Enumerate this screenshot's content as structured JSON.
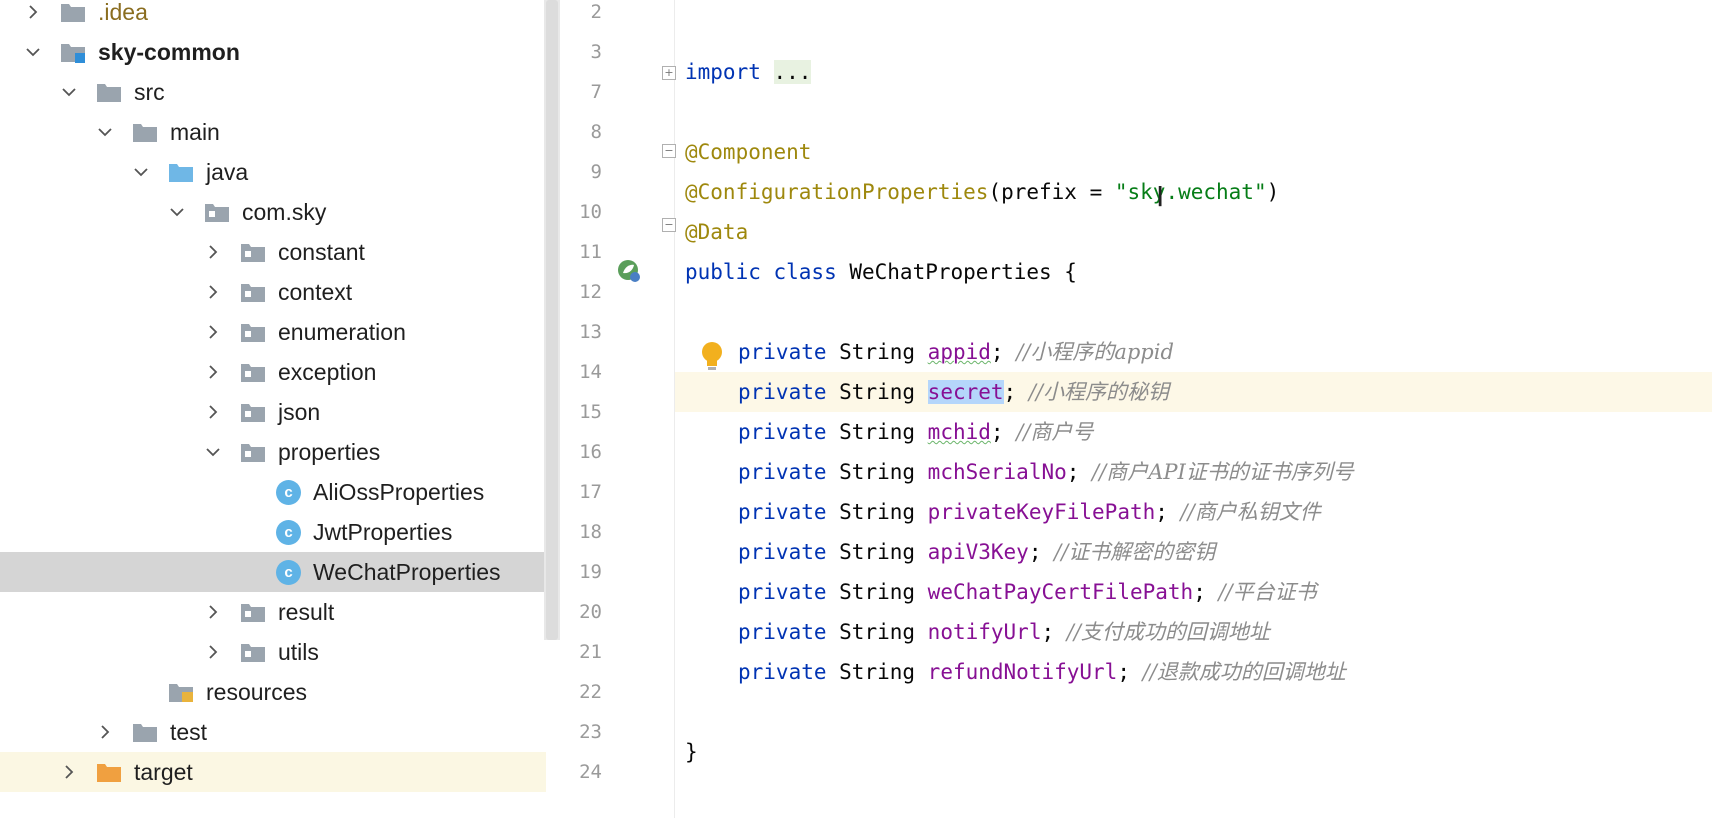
{
  "project_tree": {
    "items": [
      {
        "label": ".idea",
        "arrow": "right",
        "icon": "folder-icon"
      },
      {
        "label": "sky-common",
        "arrow": "down",
        "icon": "module-folder-icon"
      },
      {
        "label": "src",
        "arrow": "down",
        "icon": "folder-icon"
      },
      {
        "label": "main",
        "arrow": "down",
        "icon": "folder-icon"
      },
      {
        "label": "java",
        "arrow": "down",
        "icon": "source-folder-icon"
      },
      {
        "label": "com.sky",
        "arrow": "down",
        "icon": "package-icon"
      },
      {
        "label": "constant",
        "arrow": "right",
        "icon": "package-icon"
      },
      {
        "label": "context",
        "arrow": "right",
        "icon": "package-icon"
      },
      {
        "label": "enumeration",
        "arrow": "right",
        "icon": "package-icon"
      },
      {
        "label": "exception",
        "arrow": "right",
        "icon": "package-icon"
      },
      {
        "label": "json",
        "arrow": "right",
        "icon": "package-icon"
      },
      {
        "label": "properties",
        "arrow": "down",
        "icon": "package-icon"
      },
      {
        "label": "AliOssProperties",
        "arrow": "none",
        "icon": "class-icon"
      },
      {
        "label": "JwtProperties",
        "arrow": "none",
        "icon": "class-icon"
      },
      {
        "label": "WeChatProperties",
        "arrow": "none",
        "icon": "class-icon"
      },
      {
        "label": "result",
        "arrow": "right",
        "icon": "package-icon"
      },
      {
        "label": "utils",
        "arrow": "right",
        "icon": "package-icon"
      },
      {
        "label": "resources",
        "arrow": "none",
        "icon": "resources-folder-icon"
      },
      {
        "label": "test",
        "arrow": "right",
        "icon": "folder-icon"
      },
      {
        "label": "target",
        "arrow": "right",
        "icon": "excluded-folder-icon"
      }
    ],
    "class_icon_letter": "c",
    "selected": "WeChatProperties"
  },
  "editor": {
    "line_numbers": [
      "2",
      "3",
      "7",
      "8",
      "9",
      "10",
      "11",
      "12",
      "13",
      "14",
      "15",
      "16",
      "17",
      "18",
      "19",
      "20",
      "21",
      "22",
      "23",
      "24"
    ],
    "import_kw": "import",
    "import_dots": "...",
    "ann_component": "@Component",
    "ann_config": "@ConfigurationProperties",
    "prefix_open": "(prefix = ",
    "prefix_value": "\"sky.wechat\"",
    "prefix_close": ")",
    "ann_data": "@Data",
    "class_decl_kw": "public class",
    "class_name": " WeChatProperties {",
    "field_kw": "private",
    "field_type": " String ",
    "fields": [
      {
        "name": "appid",
        "comment": "//小程序的appid"
      },
      {
        "name": "secret",
        "comment": "//小程序的秘钥"
      },
      {
        "name": "mchid",
        "comment": "//商户号"
      },
      {
        "name": "mchSerialNo",
        "comment": "//商户API证书的证书序列号"
      },
      {
        "name": "privateKeyFilePath",
        "comment": "//商户私钥文件"
      },
      {
        "name": "apiV3Key",
        "comment": "//证书解密的密钥"
      },
      {
        "name": "weChatPayCertFilePath",
        "comment": "//平台证书"
      },
      {
        "name": "notifyUrl",
        "comment": "//支付成功的回调地址"
      },
      {
        "name": "refundNotifyUrl",
        "comment": "//退款成功的回调地址"
      }
    ],
    "closing_brace": "}",
    "caret_glyph": "Ⅰ",
    "colors": {
      "keyword": "#0033b3",
      "annotation": "#9e880d",
      "string": "#067d17",
      "field": "#871094",
      "comment": "#8c8c8c",
      "selection": "#b5d6fb",
      "current_line": "#fdf8e7"
    }
  }
}
